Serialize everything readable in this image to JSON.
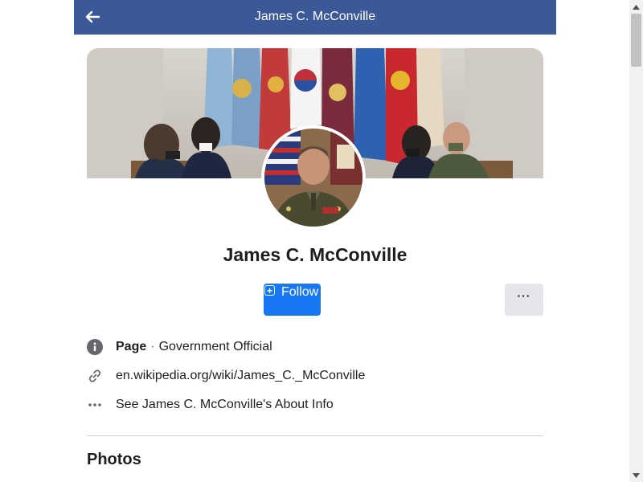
{
  "header": {
    "title": "James C. McConville",
    "back_icon": "arrow-left-icon",
    "background": "#3b5998"
  },
  "profile": {
    "name": "James C. McConville",
    "cover_image": "cover-photo",
    "avatar_image": "profile-photo"
  },
  "actions": {
    "follow_label": "Follow",
    "follow_icon": "plus-square-icon",
    "more_label": "···",
    "accent": "#1877f2"
  },
  "info": {
    "category_strong": "Page",
    "separator": "·",
    "category": "Government Official",
    "website": "en.wikipedia.org/wiki/James_C._McConville",
    "about": "See James C. McConville's About Info"
  },
  "sections": {
    "photos_title": "Photos"
  }
}
